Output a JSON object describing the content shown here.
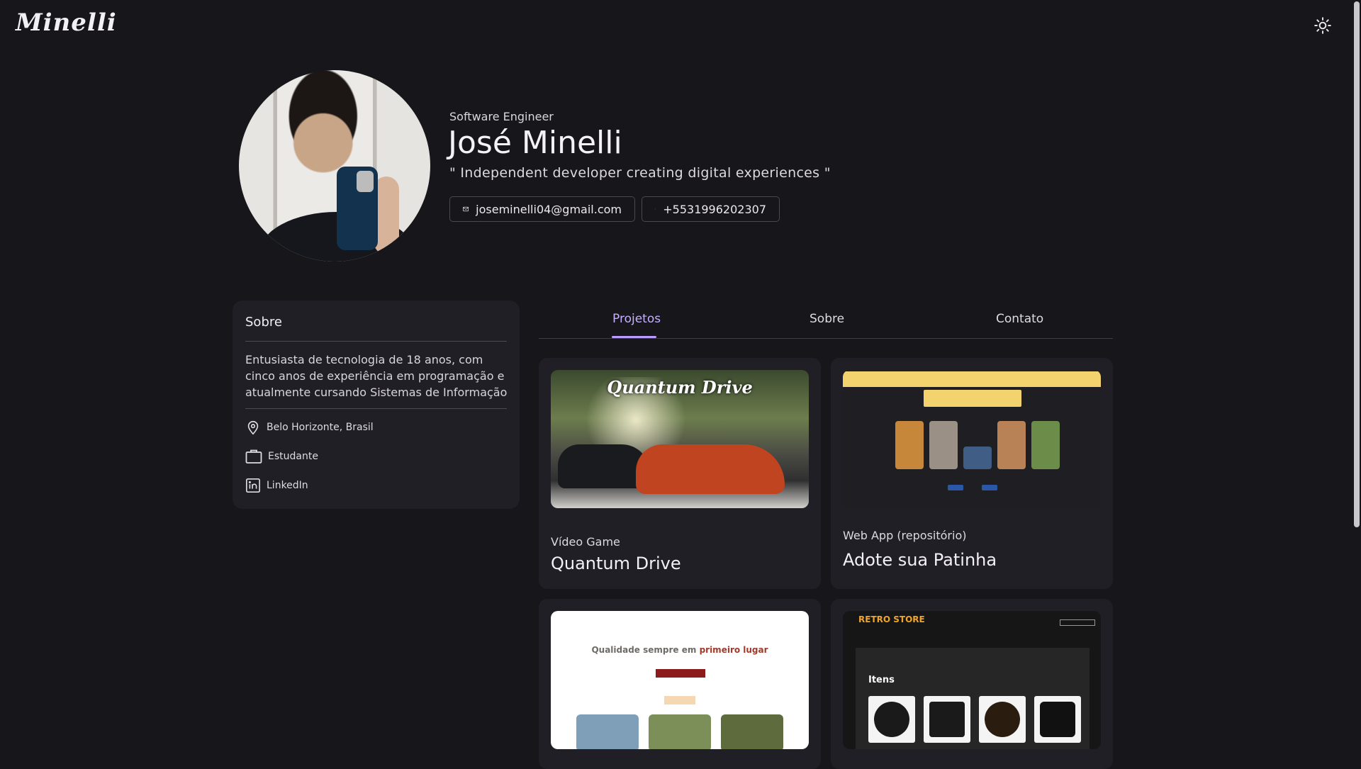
{
  "brand": {
    "logo_text": "Minelli"
  },
  "header": {
    "theme_toggle_icon": "sun-icon"
  },
  "profile": {
    "role": "Software Engineer",
    "name": "José Minelli",
    "tagline": "\" Independent developer creating digital experiences \"",
    "email": "joseminelli04@gmail.com",
    "phone": "+5531996202307"
  },
  "about": {
    "title": "Sobre",
    "text": "Entusiasta de tecnologia de 18 anos, com cinco anos de experiência em programação e atualmente cursando Sistemas de Informação",
    "items": [
      {
        "icon": "location-pin-icon",
        "label": "Belo Horizonte, Brasil"
      },
      {
        "icon": "briefcase-icon",
        "label": "Estudante"
      },
      {
        "icon": "linkedin-icon",
        "label": "LinkedIn"
      }
    ]
  },
  "tabs": [
    {
      "label": "Projetos",
      "active": true
    },
    {
      "label": "Sobre",
      "active": false
    },
    {
      "label": "Contato",
      "active": false
    }
  ],
  "projects": [
    {
      "category": "Vídeo Game",
      "title": "Quantum Drive",
      "thumb_title": "Quantum Drive"
    },
    {
      "category": "Web App (repositório)",
      "title": "Adote sua Patinha"
    },
    {
      "headline_prefix": "Qualidade sempre em",
      "headline_highlight": "primeiro lugar"
    },
    {
      "thumb_logo": "RETRO STORE",
      "thumb_heading": "Itens"
    }
  ],
  "colors": {
    "background": "#17161b",
    "card": "#211f26",
    "accent": "#b89cff"
  }
}
